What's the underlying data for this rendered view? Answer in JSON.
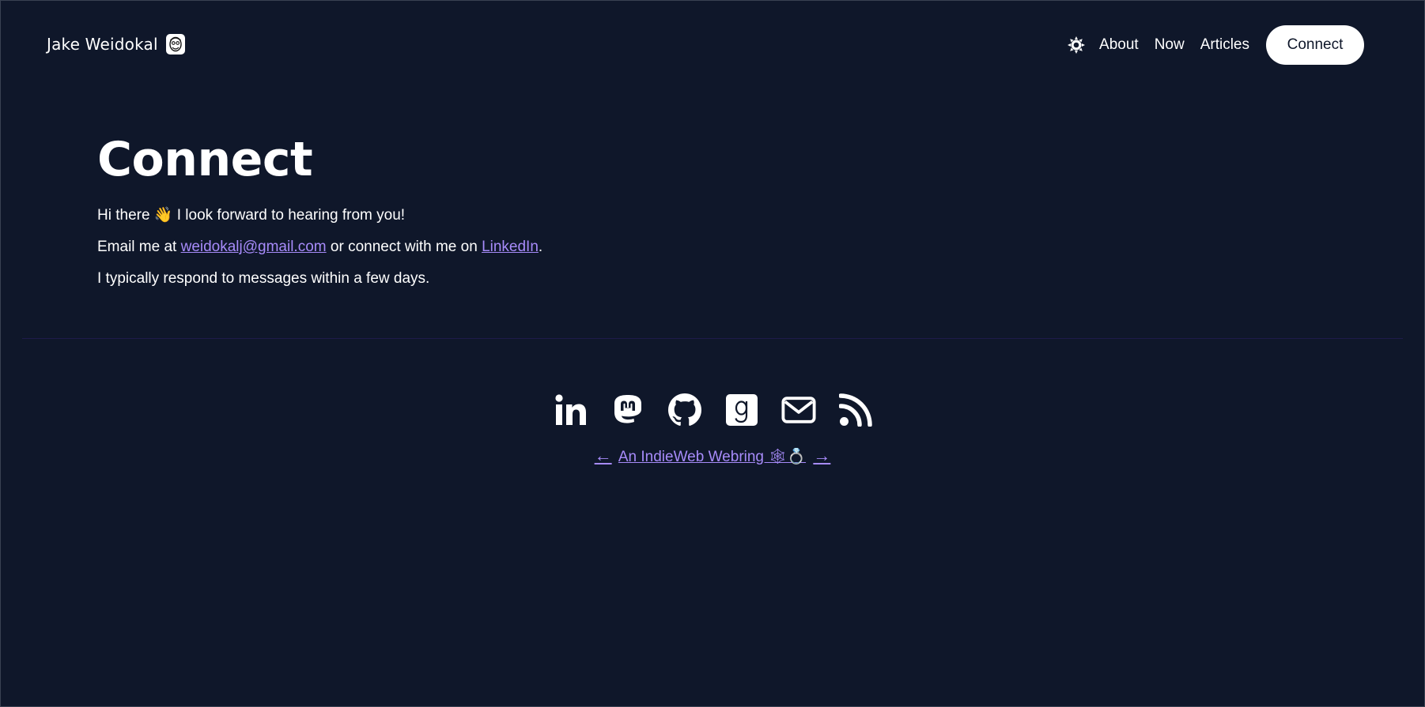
{
  "header": {
    "brand_name": "Jake Weidokal",
    "nav": {
      "about": "About",
      "now": "Now",
      "articles": "Articles",
      "connect": "Connect"
    }
  },
  "main": {
    "title": "Connect",
    "greeting": "Hi there 👋 I look forward to hearing from you!",
    "email_prefix": "Email me at ",
    "email": "weidokalj@gmail.com",
    "email_middle": " or connect with me on ",
    "linkedin_label": "LinkedIn",
    "email_suffix": ".",
    "response_note": "I typically respond to messages within a few days."
  },
  "footer": {
    "social_icons": [
      "linkedin-icon",
      "mastodon-icon",
      "github-icon",
      "goodreads-icon",
      "email-icon",
      "rss-icon"
    ],
    "webring_prev": "←",
    "webring_label": "An IndieWeb Webring 🕸💍",
    "webring_next": "→"
  },
  "colors": {
    "background": "#0f172a",
    "text": "#ffffff",
    "link": "#a78bfa",
    "button_bg": "#ffffff",
    "button_text": "#0f172a"
  }
}
